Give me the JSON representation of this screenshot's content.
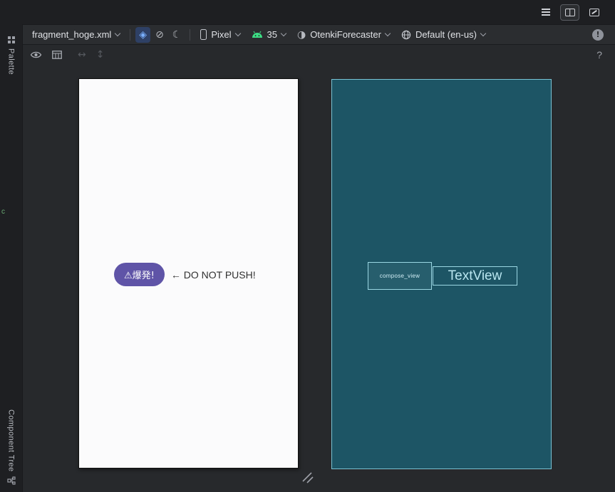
{
  "topbar": {
    "view_modes": [
      "code",
      "split",
      "design"
    ],
    "active_view_mode": "split"
  },
  "toolbar": {
    "file_name": "fragment_hoge.xml",
    "device": "Pixel",
    "api_level": "35",
    "theme": "OtenkiForecaster",
    "locale": "Default (en-us)"
  },
  "icons": {
    "layers_glyph": "◈",
    "no_frame_glyph": "⊘",
    "night_glyph": "☾",
    "theme_glyph": "◑",
    "pan_h_glyph": "↔",
    "pan_v_glyph": "↕",
    "help_glyph": "?",
    "error_glyph": "!"
  },
  "sidebar": {
    "palette": "Palette",
    "component_tree": "Component Tree",
    "marker": "c"
  },
  "design_preview": {
    "button_label": "⚠爆発!",
    "annotation": "← DO NOT PUSH!"
  },
  "blueprint": {
    "compose_label": "compose_view",
    "textview_label": "TextView"
  },
  "colors": {
    "accent_blue": "#3574F0",
    "android_green": "#3DDC84",
    "button_purple": "#5F54A7",
    "blueprint_bg": "#1D5565",
    "blueprint_line": "#9BD7E3",
    "preview_bg": "#FBFBFC",
    "topbar_bg": "#1E1F22",
    "toolbar_bg": "#2B2D30",
    "canvas_bg": "#27292C"
  }
}
